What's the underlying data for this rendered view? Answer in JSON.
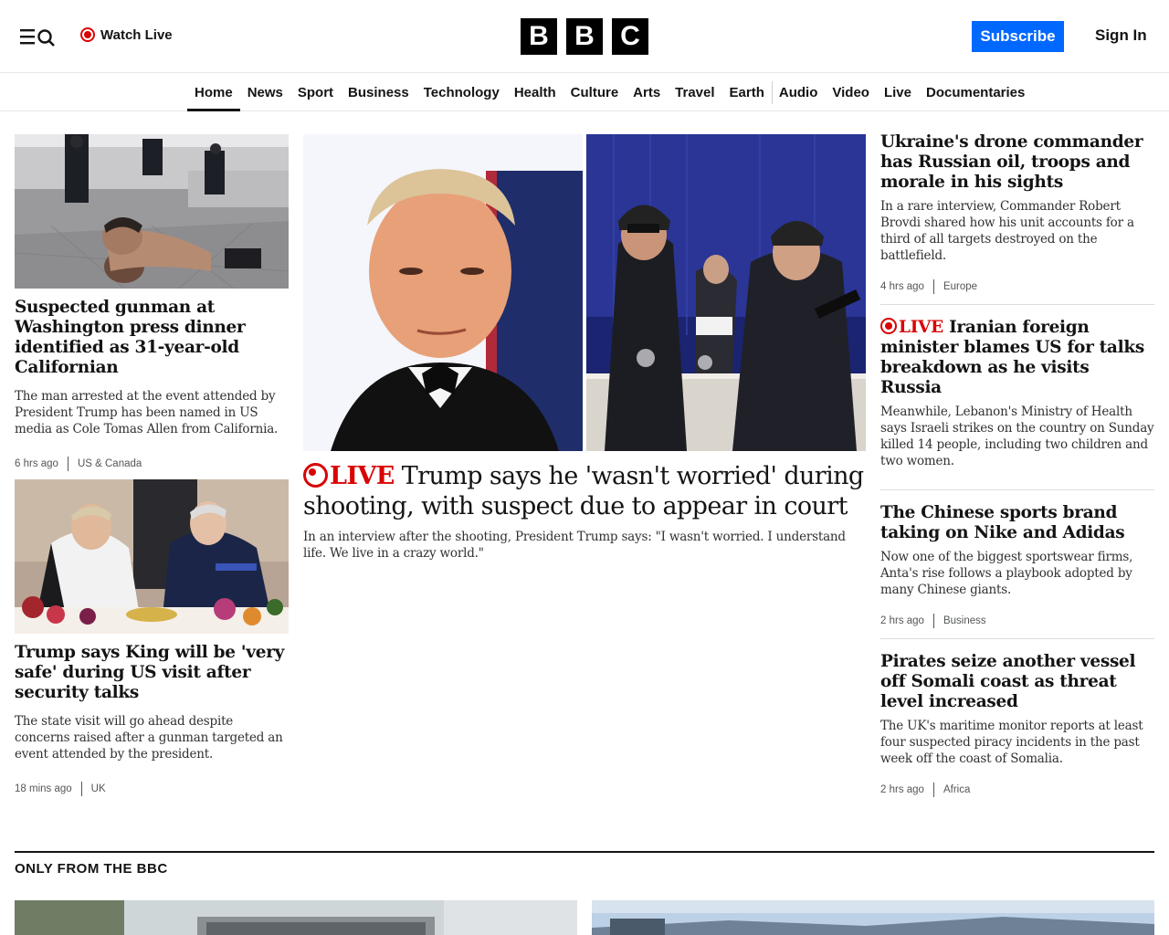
{
  "header": {
    "watch_live": "Watch Live",
    "logo_letters": [
      "B",
      "B",
      "C"
    ],
    "subscribe": "Subscribe",
    "sign_in": "Sign In"
  },
  "nav": {
    "items": [
      "Home",
      "News",
      "Sport",
      "Business",
      "Technology",
      "Health",
      "Culture",
      "Arts",
      "Travel",
      "Earth",
      "Audio",
      "Video",
      "Live",
      "Documentaries"
    ],
    "active": "Home"
  },
  "left": {
    "story1": {
      "headline": "Suspected gunman at Washington press dinner identified as 31-year-old Californian",
      "summary": "The man arrested at the event attended by President Trump has been named in US media as Cole Tomas Allen from California.",
      "time": "6 hrs ago",
      "section": "US & Canada"
    },
    "story2": {
      "headline": "Trump says King will be 'very safe' during US visit after security talks",
      "summary": "The state visit will go ahead despite concerns raised after a gunman targeted an event attended by the president.",
      "time": "18 mins ago",
      "section": "UK"
    }
  },
  "center": {
    "live_label": "LIVE",
    "headline": "Trump says he 'wasn't worried' during shooting, with suspect due to appear in court",
    "summary": "In an interview after the shooting, President Trump says: \"I wasn't worried. I understand life. We live in a crazy world.\""
  },
  "right": {
    "story1": {
      "headline": "Ukraine's drone commander has Russian oil, troops and morale in his sights",
      "summary": "In a rare interview, Commander Robert Brovdi shared how his unit accounts for a third of all targets destroyed on the battlefield.",
      "time": "4 hrs ago",
      "section": "Europe"
    },
    "story2": {
      "live_label": "LIVE",
      "headline": "Iranian foreign minister blames US for talks breakdown as he visits Russia",
      "summary": "Meanwhile, Lebanon's Ministry of Health says Israeli strikes on the country on Sunday killed 14 people, including two children and two women."
    },
    "story3": {
      "headline": "The Chinese sports brand taking on Nike and Adidas",
      "summary": "Now one of the biggest sportswear firms, Anta's rise follows a playbook adopted by many Chinese giants.",
      "time": "2 hrs ago",
      "section": "Business"
    },
    "story4": {
      "headline": "Pirates seize another vessel off Somali coast as threat level increased",
      "summary": "The UK's maritime monitor reports at least four suspected piracy incidents in the past week off the coast of Somalia.",
      "time": "2 hrs ago",
      "section": "Africa"
    }
  },
  "only_from_bbc": {
    "title": "ONLY FROM THE BBC"
  }
}
